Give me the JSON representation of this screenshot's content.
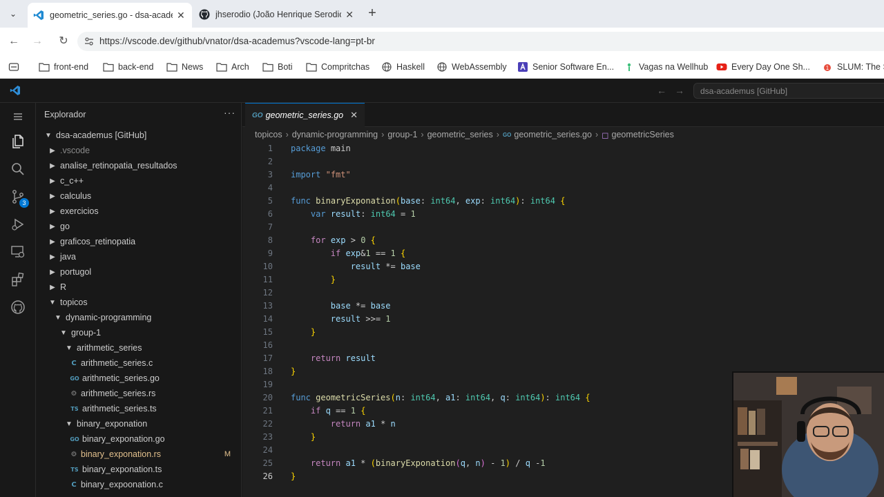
{
  "browser": {
    "tabs": [
      {
        "title": "geometric_series.go - dsa-academus",
        "active": true
      },
      {
        "title": "jhserodio (João Henrique Serodio)",
        "active": false
      }
    ],
    "url": "https://vscode.dev/github/vnator/dsa-academus?vscode-lang=pt-br",
    "bookmarks": [
      "front-end",
      "back-end",
      "News",
      "Arch",
      "Boti",
      "Compritchas",
      "Haskell",
      "WebAssembly",
      "Senior Software En...",
      "Vagas na Wellhub",
      "Every Day One Sh...",
      "SLUM: The Sh"
    ]
  },
  "vscode": {
    "command_center": "dsa-academus [GitHub]",
    "activity_badge": "3",
    "explorer": {
      "title": "Explorador",
      "root": "dsa-academus [GitHub]",
      "items": [
        {
          "label": ".vscode",
          "kind": "folder"
        },
        {
          "label": "analise_retinopatia_resultados",
          "kind": "folder"
        },
        {
          "label": "c_c++",
          "kind": "folder"
        },
        {
          "label": "calculus",
          "kind": "folder"
        },
        {
          "label": "exercicios",
          "kind": "folder"
        },
        {
          "label": "go",
          "kind": "folder"
        },
        {
          "label": "graficos_retinopatia",
          "kind": "folder"
        },
        {
          "label": "java",
          "kind": "folder"
        },
        {
          "label": "portugol",
          "kind": "folder"
        },
        {
          "label": "R",
          "kind": "folder"
        },
        {
          "label": "topicos",
          "kind": "folder-open"
        },
        {
          "label": "dynamic-programming",
          "kind": "folder-open"
        },
        {
          "label": "group-1",
          "kind": "folder-open"
        },
        {
          "label": "arithmetic_series",
          "kind": "folder-open"
        },
        {
          "label": "arithmetic_series.c",
          "kind": "c"
        },
        {
          "label": "arithmetic_series.go",
          "kind": "go"
        },
        {
          "label": "arithmetic_series.rs",
          "kind": "rs"
        },
        {
          "label": "arithmetic_series.ts",
          "kind": "ts"
        },
        {
          "label": "binary_exponation",
          "kind": "folder-open"
        },
        {
          "label": "binary_exponation.go",
          "kind": "go"
        },
        {
          "label": "binary_exponation.rs",
          "kind": "rs",
          "status": "M"
        },
        {
          "label": "binary_exponation.ts",
          "kind": "ts"
        },
        {
          "label": "binary_expoonation.c",
          "kind": "c"
        }
      ]
    },
    "editor": {
      "tab_label": "geometric_series.go",
      "breadcrumbs": [
        "topicos",
        "dynamic-programming",
        "group-1",
        "geometric_series",
        "geometric_series.go",
        "geometricSeries"
      ],
      "lines": [
        "package main",
        "",
        "import \"fmt\"",
        "",
        "func binaryExponation(base: int64, exp: int64): int64 {",
        "    var result: int64 = 1",
        "",
        "    for exp > 0 {",
        "        if exp&1 == 1 {",
        "            result *= base",
        "        }",
        "",
        "        base *= base",
        "        result >>= 1",
        "    }",
        "",
        "    return result",
        "}",
        "",
        "func geometricSeries(n: int64, a1: int64, q: int64): int64 {",
        "    if q == 1 {",
        "        return a1 * n",
        "    }",
        "",
        "    return a1 * (binaryExponation(q, n) - 1) / q -1",
        "}"
      ]
    }
  }
}
